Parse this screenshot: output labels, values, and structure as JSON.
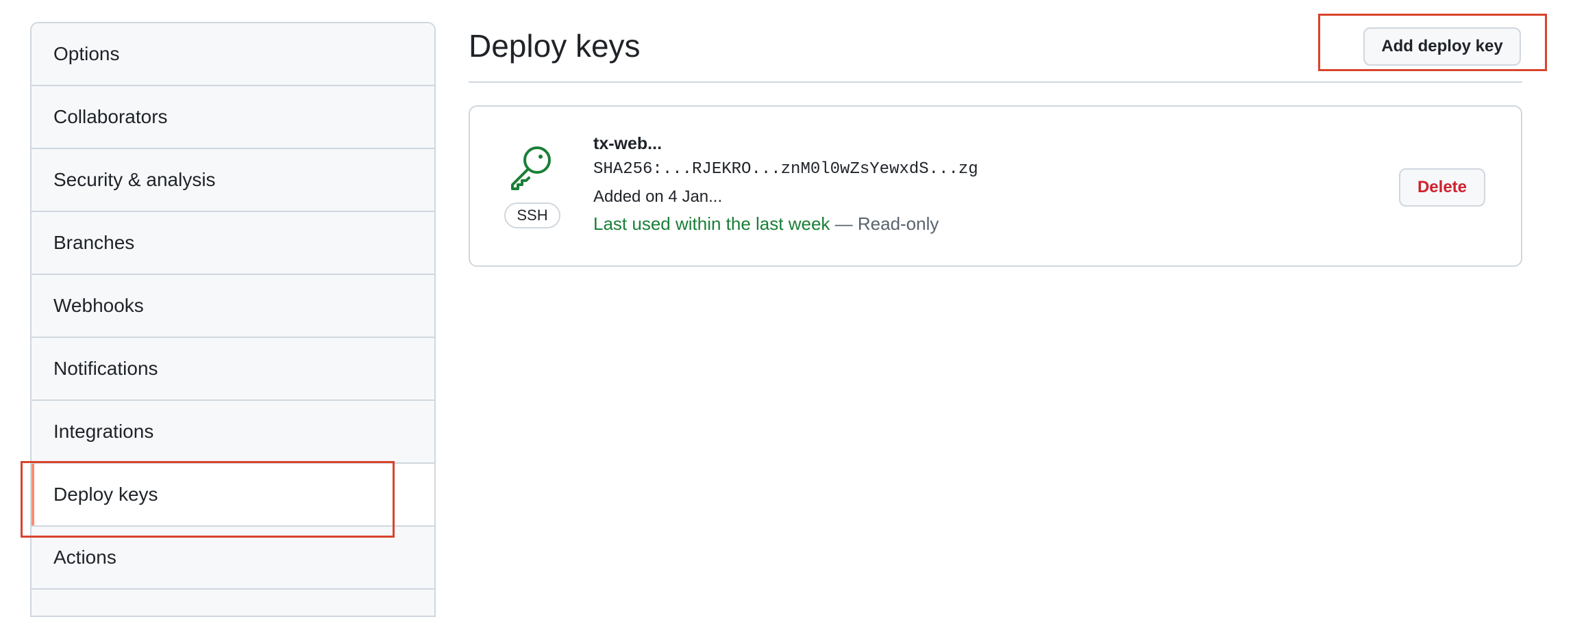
{
  "sidebar": {
    "items": [
      {
        "label": "Options"
      },
      {
        "label": "Collaborators"
      },
      {
        "label": "Security & analysis"
      },
      {
        "label": "Branches"
      },
      {
        "label": "Webhooks"
      },
      {
        "label": "Notifications"
      },
      {
        "label": "Integrations"
      },
      {
        "label": "Deploy keys",
        "selected": true
      },
      {
        "label": "Actions"
      }
    ]
  },
  "main": {
    "title": "Deploy keys",
    "add_button": "Add deploy key",
    "keys": [
      {
        "title": "tx-web...",
        "fingerprint": "SHA256:...RJEKRO...znM0l0wZsYewxdS...zg",
        "added": "Added on 4 Jan...",
        "last_used": "Last used within the last week",
        "access": " — Read-only",
        "type_badge": "SSH",
        "delete_label": "Delete"
      }
    ]
  },
  "colors": {
    "accent_selected": "#fd8c73",
    "highlight_box": "#d9432c",
    "key_icon": "#1a7f37",
    "danger": "#cf222e"
  },
  "icons": {
    "key": "key-icon"
  }
}
